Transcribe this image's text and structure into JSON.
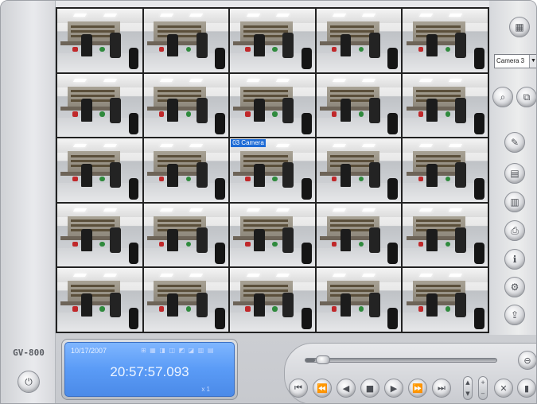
{
  "app": {
    "brand": "GV-800"
  },
  "grid": {
    "rows": 5,
    "cols": 5,
    "highlight_label": "03 Camera"
  },
  "sidebar": {
    "camera_select": {
      "value": "Camera 3"
    },
    "buttons": [
      {
        "name": "layout-icon"
      },
      {
        "name": "zoom-icon"
      },
      {
        "name": "copy-icon"
      },
      {
        "name": "tools-icon"
      },
      {
        "name": "save-icon"
      },
      {
        "name": "save-all-icon"
      },
      {
        "name": "print-icon"
      },
      {
        "name": "info-icon"
      },
      {
        "name": "settings-icon"
      },
      {
        "name": "export-icon"
      }
    ]
  },
  "status": {
    "date": "10/17/2007",
    "time": "20:57:57.093",
    "speed": "x 1",
    "icons": "⊞ ▦ ◨ ◫ ◩ ◪ ▥ ▤"
  },
  "playback": {
    "progress": 0.05,
    "controls": [
      "fast-rewind",
      "step-back",
      "rewind",
      "stop",
      "play",
      "step-forward",
      "fast-forward"
    ]
  }
}
